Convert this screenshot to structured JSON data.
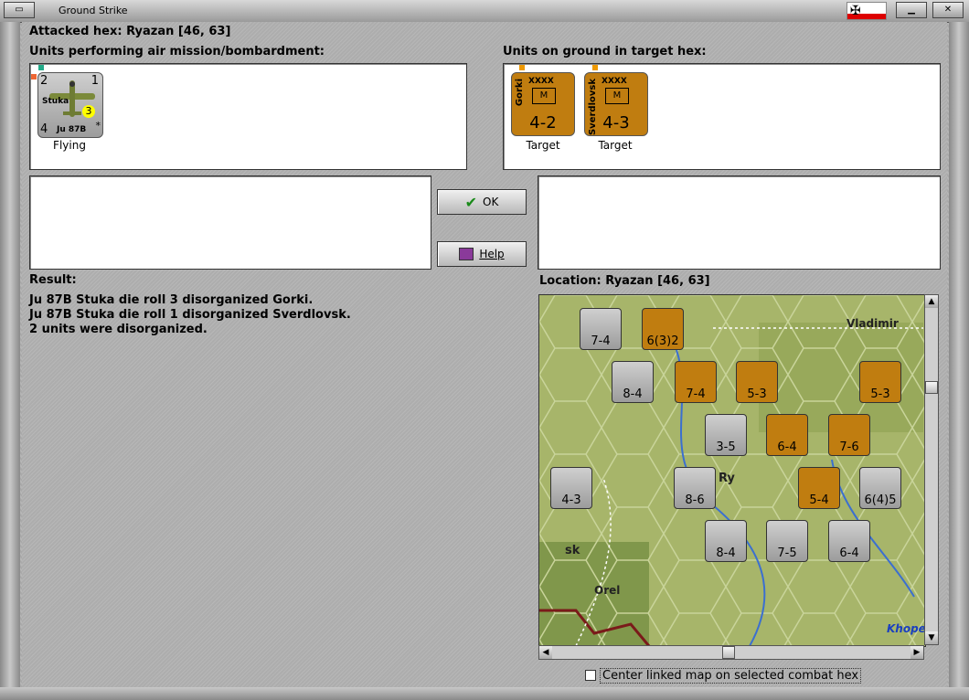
{
  "window": {
    "title": "Ground Strike"
  },
  "header": {
    "attacked_hex": "Attacked hex: Ryazan  [46, 63]",
    "air_units_label": "Units performing air mission/bombardment:",
    "ground_units_label": "Units on ground in target hex:"
  },
  "air_units": [
    {
      "name": "Stuka",
      "type": "Ju 87B",
      "top_left": "2",
      "top_right": "1",
      "bottom_left": "4",
      "badge": "3",
      "status": "Flying"
    }
  ],
  "ground_units": [
    {
      "name": "Gorki",
      "size": "XXXX",
      "symbol": "M",
      "strength": "4-2",
      "status": "Target"
    },
    {
      "name": "Sverdlovsk",
      "size": "XXXX",
      "symbol": "M",
      "strength": "4-3",
      "status": "Target"
    }
  ],
  "buttons": {
    "ok": "OK",
    "help": "Help"
  },
  "result": {
    "label": "Result:",
    "lines": [
      "Ju 87B Stuka die roll 3 disorganized Gorki.",
      "Ju 87B Stuka die roll 1 disorganized Sverdlovsk.",
      "2 units were disorganized."
    ]
  },
  "location": {
    "label": "Location:  Ryazan  [46, 63]"
  },
  "map": {
    "place_names": [
      "Vladimir",
      "Ry",
      "Orel",
      "sk",
      "Khope"
    ],
    "counters": [
      {
        "label": "7-4",
        "color": "grey"
      },
      {
        "label": "6(3)2",
        "color": "orange"
      },
      {
        "label": "7-4",
        "color": "orange"
      },
      {
        "label": "5-3",
        "color": "orange"
      },
      {
        "label": "5-3",
        "color": "orange"
      },
      {
        "label": "8-4",
        "color": "grey"
      },
      {
        "label": "3-5",
        "color": "grey"
      },
      {
        "label": "6-4",
        "color": "orange"
      },
      {
        "label": "7-6",
        "color": "orange"
      },
      {
        "label": "4-3",
        "color": "grey"
      },
      {
        "label": "8-6",
        "color": "grey"
      },
      {
        "label": "5-4",
        "color": "orange"
      },
      {
        "label": "6(4)5",
        "color": "grey"
      },
      {
        "label": "8-4",
        "color": "grey"
      },
      {
        "label": "7-5",
        "color": "grey"
      },
      {
        "label": "6-4",
        "color": "grey"
      }
    ]
  },
  "footer": {
    "center_checkbox": "Center linked map on selected combat hex"
  }
}
